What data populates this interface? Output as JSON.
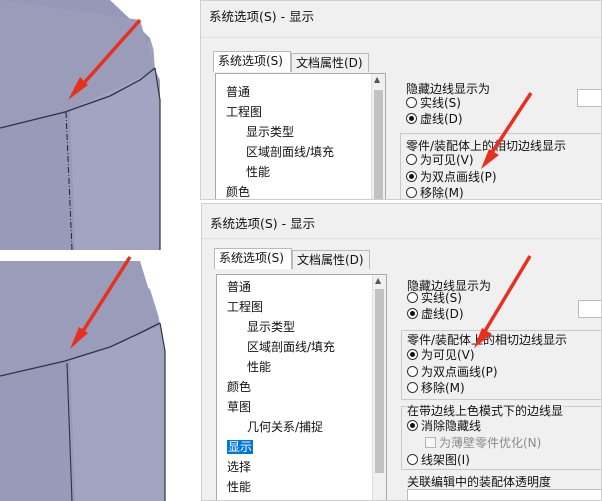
{
  "top_dialog": {
    "title": "系统选项(S) - 显示",
    "tabs": [
      "系统选项(S)",
      "文档属性(D)"
    ],
    "tree_items": [
      "普通",
      "工程图",
      "显示类型",
      "区域剖面线/填充",
      "性能",
      "颜色"
    ],
    "hidden_group_label": "隐藏边线显示为",
    "hidden_options": [
      "实线(S)",
      "虚线(D)"
    ],
    "hidden_selected": 1,
    "tangent_group_label": "零件/装配体上的相切边线显示",
    "tangent_options": [
      "为可见(V)",
      "为双点画线(P)",
      "移除(M)"
    ],
    "tangent_selected": 1
  },
  "bottom_dialog": {
    "title": "系统选项(S) - 显示",
    "tabs": [
      "系统选项(S)",
      "文档属性(D)"
    ],
    "tree_items": [
      "普通",
      "工程图",
      "显示类型",
      "区域剖面线/填充",
      "性能",
      "颜色",
      "草图",
      "几何关系/捕捉",
      "显示",
      "选择",
      "性能"
    ],
    "tree_selected": 8,
    "hidden_group_label": "隐藏边线显示为",
    "hidden_options": [
      "实线(S)",
      "虚线(D)"
    ],
    "hidden_selected": 1,
    "tangent_group_label": "零件/装配体上的相切边线显示",
    "tangent_options": [
      "为可见(V)",
      "为双点画线(P)",
      "移除(M)"
    ],
    "tangent_selected": 0,
    "shaded_group_label": "在带边线上色模式下的边线显",
    "shaded_options": [
      "消除隐藏线",
      "线架图(I)"
    ],
    "shaded_selected": 0,
    "shaded_checkbox": "为薄壁零件优化(N)",
    "assembly_label": "关联编辑中的装配体透明度"
  },
  "colors": {
    "arrow": "#e8301f",
    "model_face": "#9fa2bd",
    "selection": "#0078d7"
  }
}
